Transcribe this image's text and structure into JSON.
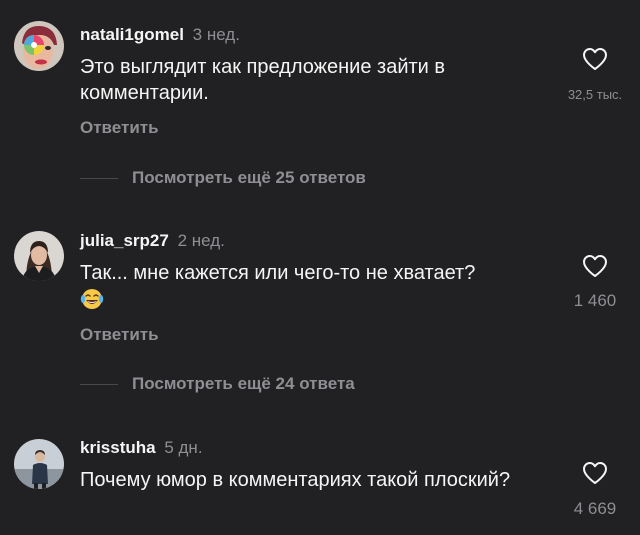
{
  "comments": [
    {
      "username": "natali1gomel",
      "time": "3 нед.",
      "text": "Это выглядит как предложение зайти в комментарии.",
      "likes": "32,5 тыс.",
      "reply_label": "Ответить",
      "view_replies_label": "Посмотреть ещё 25 ответов",
      "avatar_icon": "lollipop-avatar-icon"
    },
    {
      "username": "julia_srp27",
      "time": "2 нед.",
      "text": "Так... мне кажется или чего-то не хватает?",
      "emoji": "face-with-tears-of-joy-icon",
      "likes": "1 460",
      "reply_label": "Ответить",
      "view_replies_label": "Посмотреть ещё 24 ответа",
      "avatar_icon": "woman-portrait-avatar-icon"
    },
    {
      "username": "krisstuha",
      "time": "5 дн.",
      "text": "Почему юмор в комментариях такой плоский?",
      "likes": "4 669",
      "avatar_icon": "person-figure-avatar-icon"
    }
  ],
  "colors": {
    "background": "#212123",
    "primary_text": "#f5f5f5",
    "secondary_text": "#8e8e93"
  }
}
